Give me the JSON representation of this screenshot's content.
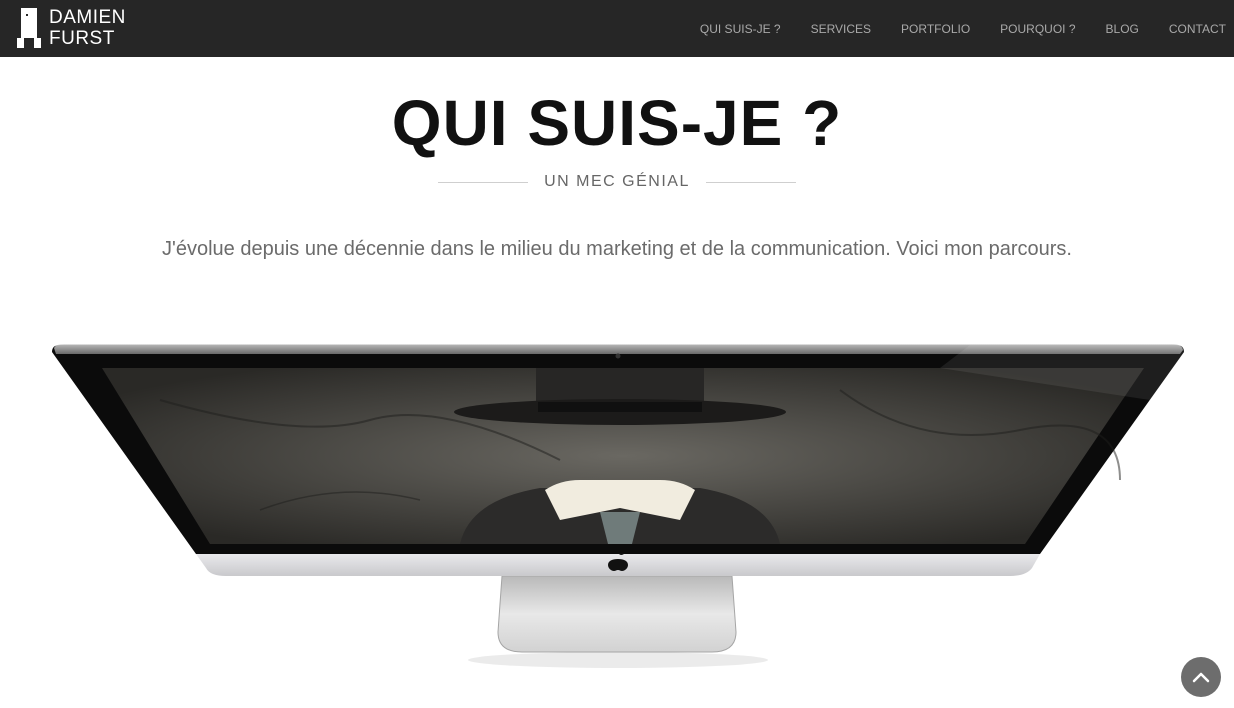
{
  "brand": {
    "line1": "DAMIEN",
    "line2": "FURST",
    "logo_icon": "tower-logo-icon"
  },
  "nav": {
    "items": [
      {
        "label": "QUI SUIS-JE ?"
      },
      {
        "label": "SERVICES"
      },
      {
        "label": "PORTFOLIO"
      },
      {
        "label": "POURQUOI ?"
      },
      {
        "label": "BLOG"
      },
      {
        "label": "CONTACT"
      }
    ]
  },
  "hero": {
    "title": "QUI SUIS-JE ?",
    "subtitle": "UN MEC GÉNIAL",
    "intro": "J'évolue depuis une décennie dans le milieu du marketing et de la communication. Voici mon parcours."
  },
  "illustration": {
    "icon": "imac-computer-icon",
    "screen_subject": "invisible-man-hat-suit-icon"
  },
  "scroll_top": {
    "icon": "chevron-up-icon"
  },
  "colors": {
    "navbar": "#262626",
    "nav_text": "#a9a9a9",
    "title": "#111111",
    "subtitle": "#666666",
    "body_text": "#6b6b6b",
    "scroll_button": "#6d6d6d"
  }
}
